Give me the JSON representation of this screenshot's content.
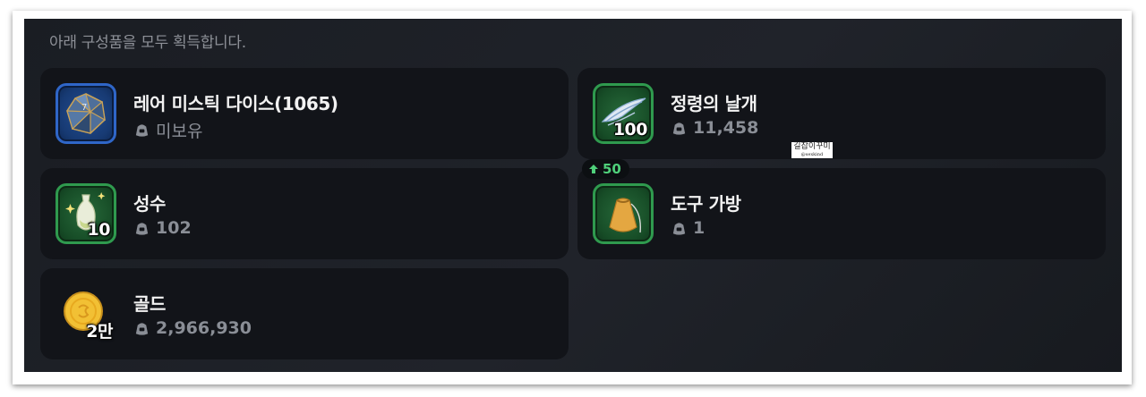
{
  "header": {
    "text": "아래 구성품을 모두 획득합니다."
  },
  "items": [
    {
      "name": "레어 미스틱 다이스(1065)",
      "owned": "미보유",
      "qty": "",
      "icon": "mystic-dice-icon",
      "frame": "blue"
    },
    {
      "name": "정령의 날개",
      "owned": "11,458",
      "qty": "100",
      "icon": "spirit-wing-icon",
      "frame": "green"
    },
    {
      "name": "성수",
      "owned": "102",
      "qty": "10",
      "icon": "holy-water-icon",
      "frame": "green"
    },
    {
      "name": "도구 가방",
      "owned": "1",
      "qty": "",
      "level": "50",
      "icon": "tool-bag-icon",
      "frame": "green"
    },
    {
      "name": "골드",
      "owned": "2,966,930",
      "qty": "2만",
      "icon": "gold-coin-icon",
      "frame": "none"
    }
  ],
  "watermark": {
    "text": "길잡이꾸미",
    "sub": "@sexkind"
  },
  "colors": {
    "green_frame": "#2f9a4e",
    "blue_frame": "#2f66c8",
    "level_green": "#4fd07a",
    "background": "#1c1f25"
  }
}
